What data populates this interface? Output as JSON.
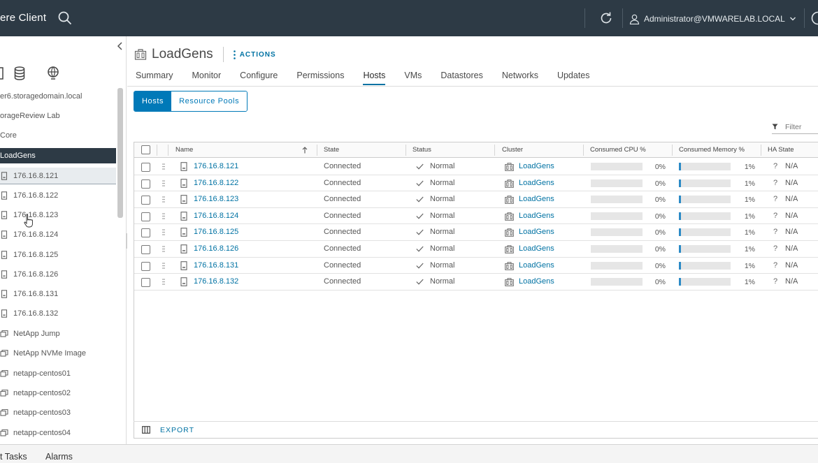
{
  "header": {
    "app_title": "ere Client",
    "user": "Administrator@VMWARELAB.LOCAL"
  },
  "navigator": {
    "items": [
      {
        "label": "er6.storagedomain.local",
        "icon": "vcenter-icon",
        "state": "normal"
      },
      {
        "label": "orageReview Lab",
        "icon": "datacenter-icon",
        "state": "normal"
      },
      {
        "label": "Core",
        "icon": "cluster-icon",
        "state": "normal"
      },
      {
        "label": "LoadGens",
        "icon": "cluster-icon",
        "state": "selected"
      },
      {
        "label": "176.16.8.121",
        "icon": "host-icon",
        "state": "hover"
      },
      {
        "label": "176.16.8.122",
        "icon": "host-icon",
        "state": "normal"
      },
      {
        "label": "176.16.8.123",
        "icon": "host-icon",
        "state": "normal"
      },
      {
        "label": "176.16.8.124",
        "icon": "host-icon",
        "state": "normal"
      },
      {
        "label": "176.16.8.125",
        "icon": "host-icon",
        "state": "normal"
      },
      {
        "label": "176.16.8.126",
        "icon": "host-icon",
        "state": "normal"
      },
      {
        "label": "176.16.8.131",
        "icon": "host-icon",
        "state": "normal"
      },
      {
        "label": "176.16.8.132",
        "icon": "host-icon",
        "state": "normal"
      },
      {
        "label": "NetApp Jump",
        "icon": "vm-icon",
        "state": "normal"
      },
      {
        "label": "NetApp NVMe Image",
        "icon": "vm-icon",
        "state": "normal"
      },
      {
        "label": "netapp-centos01",
        "icon": "vm-icon",
        "state": "normal"
      },
      {
        "label": "netapp-centos02",
        "icon": "vm-icon",
        "state": "normal"
      },
      {
        "label": "netapp-centos03",
        "icon": "vm-icon",
        "state": "normal"
      },
      {
        "label": "netapp-centos04",
        "icon": "vm-icon",
        "state": "normal"
      }
    ]
  },
  "object": {
    "title": "LoadGens",
    "actions_label": "ACTIONS"
  },
  "tabs": [
    "Summary",
    "Monitor",
    "Configure",
    "Permissions",
    "Hosts",
    "VMs",
    "Datastores",
    "Networks",
    "Updates"
  ],
  "active_tab": "Hosts",
  "segment": {
    "hosts": "Hosts",
    "resource_pools": "Resource Pools"
  },
  "filter": {
    "placeholder": "Filter"
  },
  "grid": {
    "columns": {
      "name": "Name",
      "state": "State",
      "status": "Status",
      "cluster": "Cluster",
      "cpu": "Consumed CPU %",
      "memory": "Consumed Memory %",
      "ha": "HA State"
    },
    "rows": [
      {
        "name": "176.16.8.121",
        "state": "Connected",
        "status": "Normal",
        "cluster": "LoadGens",
        "cpu": "0%",
        "cpu_value": 0,
        "mem": "1%",
        "mem_value": 1,
        "ha_icon": "?",
        "ha": "N/A"
      },
      {
        "name": "176.16.8.122",
        "state": "Connected",
        "status": "Normal",
        "cluster": "LoadGens",
        "cpu": "0%",
        "cpu_value": 0,
        "mem": "1%",
        "mem_value": 1,
        "ha_icon": "?",
        "ha": "N/A"
      },
      {
        "name": "176.16.8.123",
        "state": "Connected",
        "status": "Normal",
        "cluster": "LoadGens",
        "cpu": "0%",
        "cpu_value": 0,
        "mem": "1%",
        "mem_value": 1,
        "ha_icon": "?",
        "ha": "N/A"
      },
      {
        "name": "176.16.8.124",
        "state": "Connected",
        "status": "Normal",
        "cluster": "LoadGens",
        "cpu": "0%",
        "cpu_value": 0,
        "mem": "1%",
        "mem_value": 1,
        "ha_icon": "?",
        "ha": "N/A"
      },
      {
        "name": "176.16.8.125",
        "state": "Connected",
        "status": "Normal",
        "cluster": "LoadGens",
        "cpu": "0%",
        "cpu_value": 0,
        "mem": "1%",
        "mem_value": 1,
        "ha_icon": "?",
        "ha": "N/A"
      },
      {
        "name": "176.16.8.126",
        "state": "Connected",
        "status": "Normal",
        "cluster": "LoadGens",
        "cpu": "0%",
        "cpu_value": 0,
        "mem": "1%",
        "mem_value": 1,
        "ha_icon": "?",
        "ha": "N/A"
      },
      {
        "name": "176.16.8.131",
        "state": "Connected",
        "status": "Normal",
        "cluster": "LoadGens",
        "cpu": "0%",
        "cpu_value": 0,
        "mem": "1%",
        "mem_value": 1,
        "ha_icon": "?",
        "ha": "N/A"
      },
      {
        "name": "176.16.8.132",
        "state": "Connected",
        "status": "Normal",
        "cluster": "LoadGens",
        "cpu": "0%",
        "cpu_value": 0,
        "mem": "1%",
        "mem_value": 1,
        "ha_icon": "?",
        "ha": "N/A"
      }
    ],
    "export_label": "EXPORT"
  },
  "bottom": {
    "recent_tasks": "t Tasks",
    "alarms": "Alarms"
  },
  "colors": {
    "header_bg": "#2d3a45",
    "accent": "#0072a3",
    "bar_fill": "#2b8ac6"
  }
}
